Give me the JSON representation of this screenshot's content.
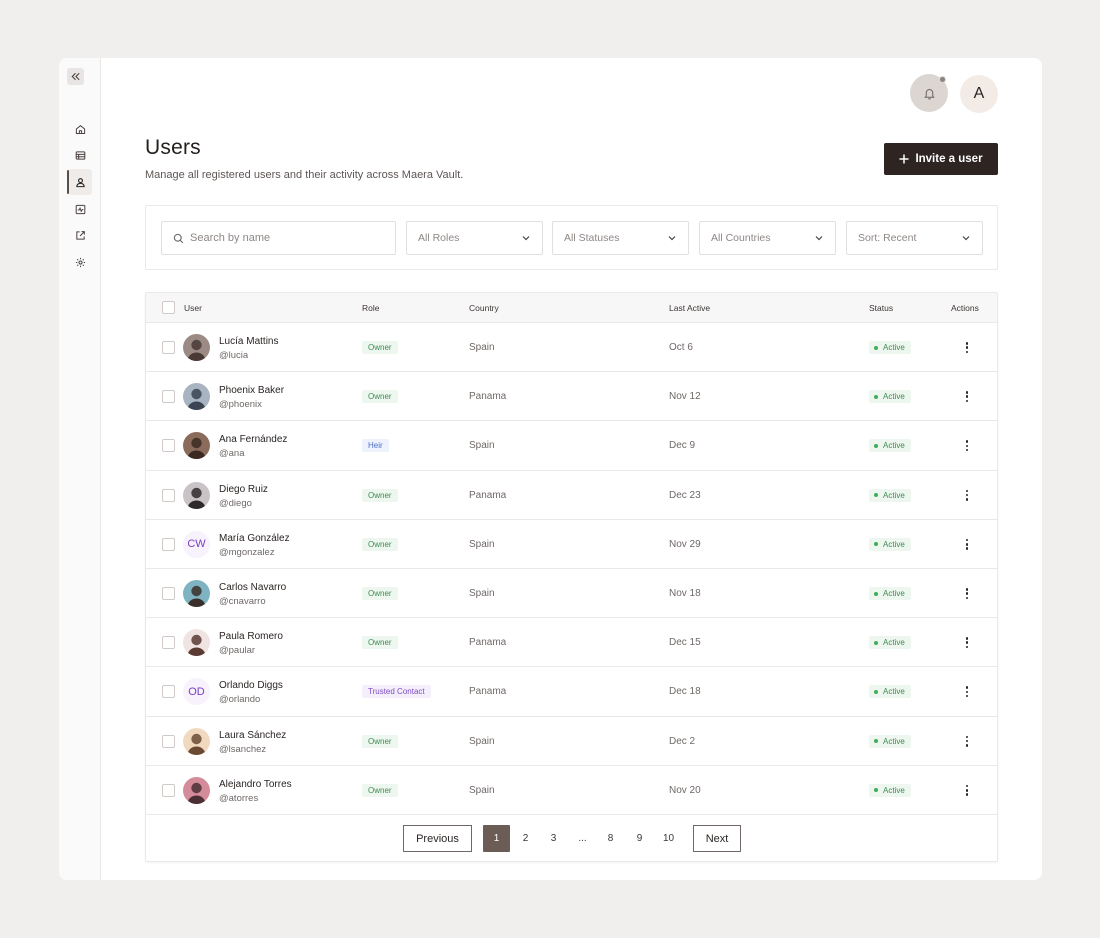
{
  "header": {
    "title": "Users",
    "subtitle": "Manage all registered users and their activity across Maera Vault.",
    "invite_label": "Invite a user",
    "account_initial": "A"
  },
  "sidebar": {
    "items": [
      {
        "name": "home-icon",
        "active": false
      },
      {
        "name": "table-icon",
        "active": false
      },
      {
        "name": "user-icon",
        "active": true
      },
      {
        "name": "activity-icon",
        "active": false
      },
      {
        "name": "external-link-icon",
        "active": false
      },
      {
        "name": "gear-icon",
        "active": false
      }
    ]
  },
  "filters": {
    "search_placeholder": "Search by name",
    "roles": "All Roles",
    "statuses": "All Statuses",
    "countries": "All Countries",
    "sort": "Sort: Recent"
  },
  "table": {
    "columns": {
      "user": "User",
      "role": "Role",
      "country": "Country",
      "last_active": "Last Active",
      "status": "Status",
      "actions": "Actions"
    },
    "rows": [
      {
        "name": "Lucía Mattins",
        "handle": "@lucia",
        "role": "Owner",
        "role_type": "owner",
        "country": "Spain",
        "last_active": "Oct 6",
        "status": "Active",
        "avatar": "photo",
        "avatar_colors": [
          "#4a3a35",
          "#9c8b84"
        ]
      },
      {
        "name": "Phoenix Baker",
        "handle": "@phoenix",
        "role": "Owner",
        "role_type": "owner",
        "country": "Panama",
        "last_active": "Nov 12",
        "status": "Active",
        "avatar": "photo",
        "avatar_colors": [
          "#3a4452",
          "#a8b4c2"
        ]
      },
      {
        "name": "Ana Fernández",
        "handle": "@ana",
        "role": "Heir",
        "role_type": "heir",
        "country": "Spain",
        "last_active": "Dec 9",
        "status": "Active",
        "avatar": "photo",
        "avatar_colors": [
          "#3b2a22",
          "#8a6b5c"
        ]
      },
      {
        "name": "Diego Ruiz",
        "handle": "@diego",
        "role": "Owner",
        "role_type": "owner",
        "country": "Panama",
        "last_active": "Dec 23",
        "status": "Active",
        "avatar": "photo",
        "avatar_colors": [
          "#2f2a2a",
          "#c9c2c6"
        ]
      },
      {
        "name": "María González",
        "handle": "@mgonzalez",
        "role": "Owner",
        "role_type": "owner",
        "country": "Spain",
        "last_active": "Nov 29",
        "status": "Active",
        "avatar": "initials",
        "initials": "CW"
      },
      {
        "name": "Carlos Navarro",
        "handle": "@cnavarro",
        "role": "Owner",
        "role_type": "owner",
        "country": "Spain",
        "last_active": "Nov 18",
        "status": "Active",
        "avatar": "photo",
        "avatar_colors": [
          "#3a2f2b",
          "#7fb3c2"
        ]
      },
      {
        "name": "Paula Romero",
        "handle": "@paular",
        "role": "Owner",
        "role_type": "owner",
        "country": "Panama",
        "last_active": "Dec 15",
        "status": "Active",
        "avatar": "photo",
        "avatar_colors": [
          "#5b3a33",
          "#efe4e2"
        ]
      },
      {
        "name": "Orlando Diggs",
        "handle": "@orlando",
        "role": "Trusted Contact",
        "role_type": "trusted",
        "country": "Panama",
        "last_active": "Dec 18",
        "status": "Active",
        "avatar": "initials",
        "initials": "OD"
      },
      {
        "name": "Laura Sánchez",
        "handle": "@lsanchez",
        "role": "Owner",
        "role_type": "owner",
        "country": "Spain",
        "last_active": "Dec 2",
        "status": "Active",
        "avatar": "photo",
        "avatar_colors": [
          "#6b4a33",
          "#f1d9bf"
        ]
      },
      {
        "name": "Alejandro Torres",
        "handle": "@atorres",
        "role": "Owner",
        "role_type": "owner",
        "country": "Spain",
        "last_active": "Nov 20",
        "status": "Active",
        "avatar": "photo",
        "avatar_colors": [
          "#4a2f35",
          "#d48c9a"
        ]
      }
    ]
  },
  "pagination": {
    "previous": "Previous",
    "next": "Next",
    "pages": [
      "1",
      "2",
      "3",
      "...",
      "8",
      "9",
      "10"
    ],
    "current": "1"
  },
  "colors": {
    "primary": "#2e2421",
    "accent_page": "#6b5d56",
    "active_green": "#3fae5a",
    "initials_purple": "#7a3fc4"
  }
}
